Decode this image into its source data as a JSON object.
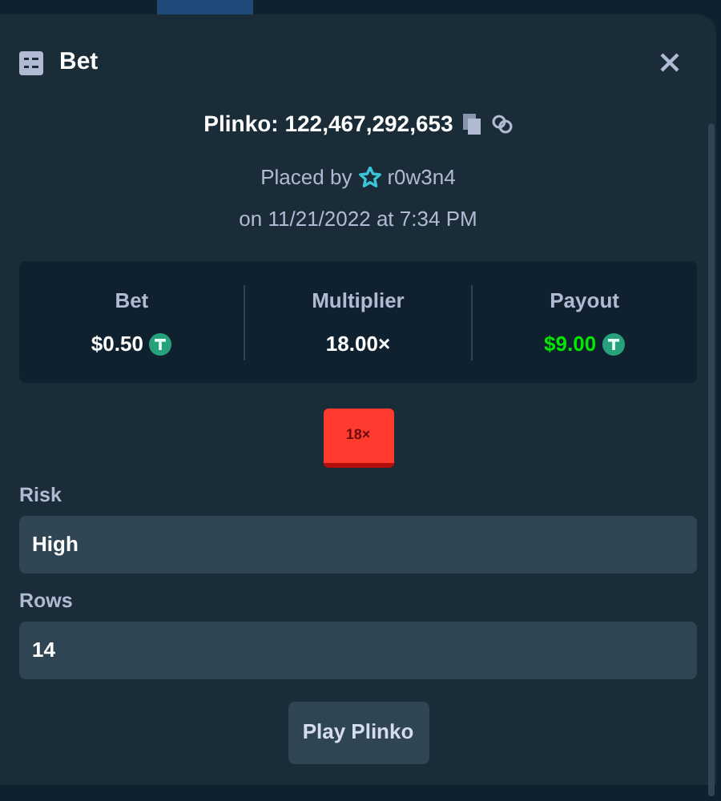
{
  "dialog": {
    "title": "Bet"
  },
  "bet": {
    "game_id": "Plinko: 122,467,292,653",
    "placed_by_label": "Placed by",
    "user": "r0w3n4",
    "date": "on 11/21/2022 at 7:34 PM"
  },
  "stats": [
    {
      "label": "Bet",
      "value": "$0.50",
      "coin": true,
      "highlight": false
    },
    {
      "label": "Multiplier",
      "value": "18.00×",
      "coin": false,
      "highlight": false
    },
    {
      "label": "Payout",
      "value": "$9.00",
      "coin": true,
      "highlight": true
    }
  ],
  "result_tile": "18×",
  "fields": [
    {
      "label": "Risk",
      "value": "High"
    },
    {
      "label": "Rows",
      "value": "14"
    }
  ],
  "play_button": "Play Plinko"
}
